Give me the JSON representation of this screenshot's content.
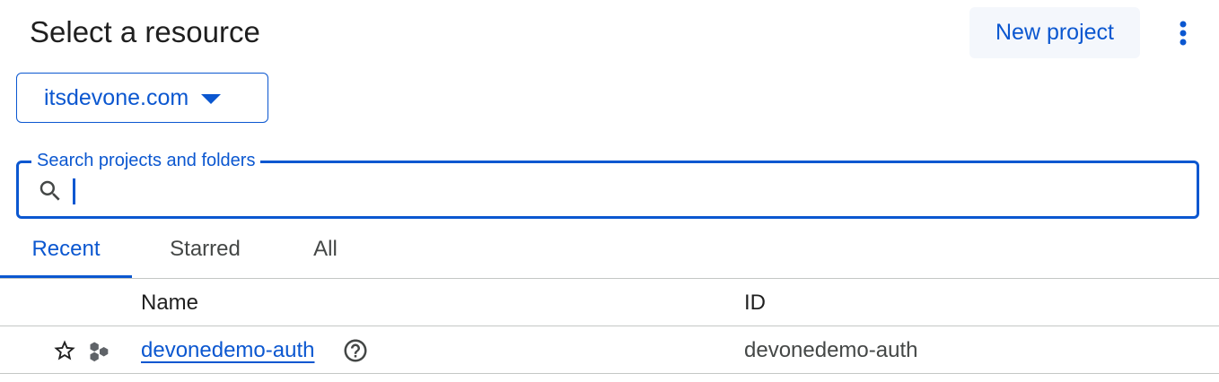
{
  "header": {
    "title": "Select a resource",
    "new_project_label": "New project"
  },
  "organization": {
    "selected": "itsdevone.com"
  },
  "search": {
    "label": "Search projects and folders",
    "value": ""
  },
  "tabs": [
    {
      "label": "Recent",
      "active": true
    },
    {
      "label": "Starred",
      "active": false
    },
    {
      "label": "All",
      "active": false
    }
  ],
  "table": {
    "columns": [
      "Name",
      "ID"
    ],
    "rows": [
      {
        "name": "devonedemo-auth",
        "id": "devonedemo-auth",
        "starred": false
      }
    ]
  },
  "colors": {
    "accent": "#0b57d0",
    "text": "#1f1f1f",
    "muted": "#444746",
    "divider": "#c4c7c5"
  },
  "icons": [
    "more-vert-icon",
    "dropdown-caret-icon",
    "search-icon",
    "star-outline-icon",
    "project-icon",
    "help-icon"
  ]
}
